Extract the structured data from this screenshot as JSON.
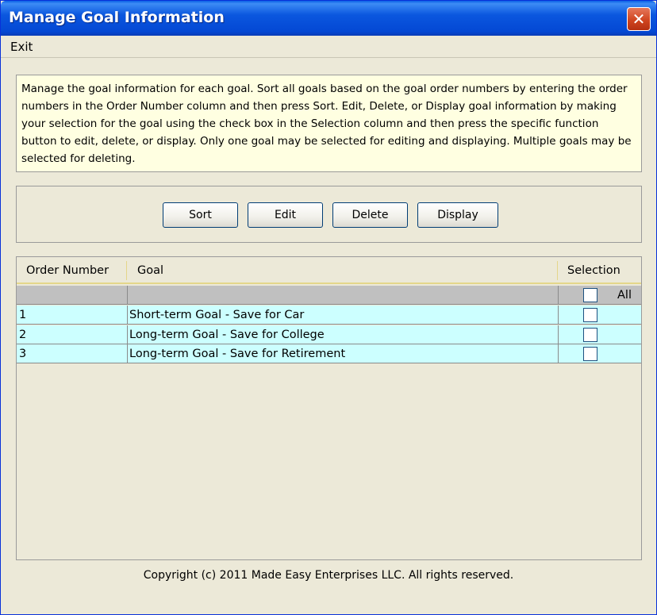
{
  "window": {
    "title": "Manage Goal Information",
    "close_label": "✕"
  },
  "menu": {
    "items": [
      {
        "label": "Exit"
      }
    ]
  },
  "info": {
    "text": "Manage the goal information for each goal. Sort all goals based on the goal order numbers by entering the order numbers in the Order Number column and then press Sort. Edit, Delete, or Display goal information by making your selection for the goal using the check box in the Selection column and then press the specific function button to edit, delete, or display. Only one goal may be selected for editing and displaying. Multiple goals may be selected for deleting."
  },
  "toolbar": {
    "sort_label": "Sort",
    "edit_label": "Edit",
    "delete_label": "Delete",
    "display_label": "Display"
  },
  "table": {
    "columns": {
      "order": "Order Number",
      "goal": "Goal",
      "selection": "Selection"
    },
    "select_all_label": "All",
    "rows": [
      {
        "order": "1",
        "goal": "Short-term Goal - Save for Car",
        "selected": false
      },
      {
        "order": "2",
        "goal": "Long-term Goal - Save for College",
        "selected": false
      },
      {
        "order": "3",
        "goal": "Long-term Goal - Save for Retirement",
        "selected": false
      }
    ]
  },
  "footer": {
    "copyright": "Copyright (c) 2011 Made Easy Enterprises LLC. All rights reserved."
  },
  "colors": {
    "title_bar": "#0b57df",
    "info_background": "#ffffe1",
    "row_background": "#ccffff",
    "filter_row_background": "#c0c0c0",
    "close_button": "#d04520"
  }
}
